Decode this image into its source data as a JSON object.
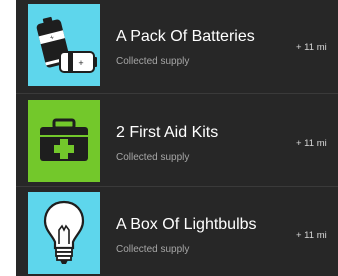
{
  "supplies": [
    {
      "title": "A Pack Of Batteries",
      "subtitle": "Collected supply",
      "reward": "+ 11 mi",
      "icon": "batteries-icon",
      "tile_color": "#5ed6ec"
    },
    {
      "title": "2 First Aid Kits",
      "subtitle": "Collected supply",
      "reward": "+ 11 mi",
      "icon": "first-aid-kit-icon",
      "tile_color": "#73c82b"
    },
    {
      "title": "A Box Of Lightbulbs",
      "subtitle": "Collected supply",
      "reward": "+ 11 mi",
      "icon": "lightbulb-icon",
      "tile_color": "#5ed6ec"
    }
  ],
  "colors": {
    "background": "#272727",
    "separator": "#3a3a3a",
    "title_text": "#ffffff",
    "subtitle_text": "#a6a6a6"
  }
}
